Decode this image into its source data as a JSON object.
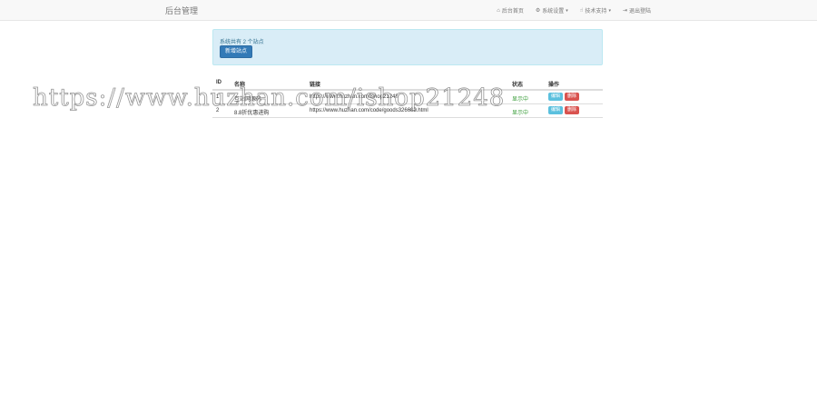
{
  "navbar": {
    "brand": "后台管理",
    "items": [
      {
        "label": "后台首页",
        "icon": "home-icon",
        "dropdown": false
      },
      {
        "label": "系统设置",
        "icon": "gear-icon",
        "dropdown": true
      },
      {
        "label": "技术支持",
        "icon": "thumbs-up-icon",
        "dropdown": true
      },
      {
        "label": "退出登陆",
        "icon": "logout-icon",
        "dropdown": false
      }
    ]
  },
  "alert": {
    "text": "系统共有 2 个站点",
    "add_button": "新增站点"
  },
  "table": {
    "headers": {
      "id": "ID",
      "name": "名称",
      "url": "链接",
      "status": "状态",
      "ops": "操作"
    },
    "rows": [
      {
        "id": "1",
        "name": "互站网源码",
        "url": "https://www.huzhan.com/ishop21248",
        "status": "显示中",
        "edit": "编辑",
        "delete": "删除"
      },
      {
        "id": "2",
        "name": "8.8折优惠进购",
        "url": "https://www.huzhan.com/code/goods326682.html",
        "status": "显示中",
        "edit": "编辑",
        "delete": "删除"
      }
    ]
  },
  "watermark": "https://www.huzhan.com/ishop21248",
  "colors": {
    "primary": "#337ab7",
    "info": "#5bc0de",
    "danger": "#d9534f",
    "alert_bg": "#d9edf7",
    "status": "#3c9e3c"
  }
}
